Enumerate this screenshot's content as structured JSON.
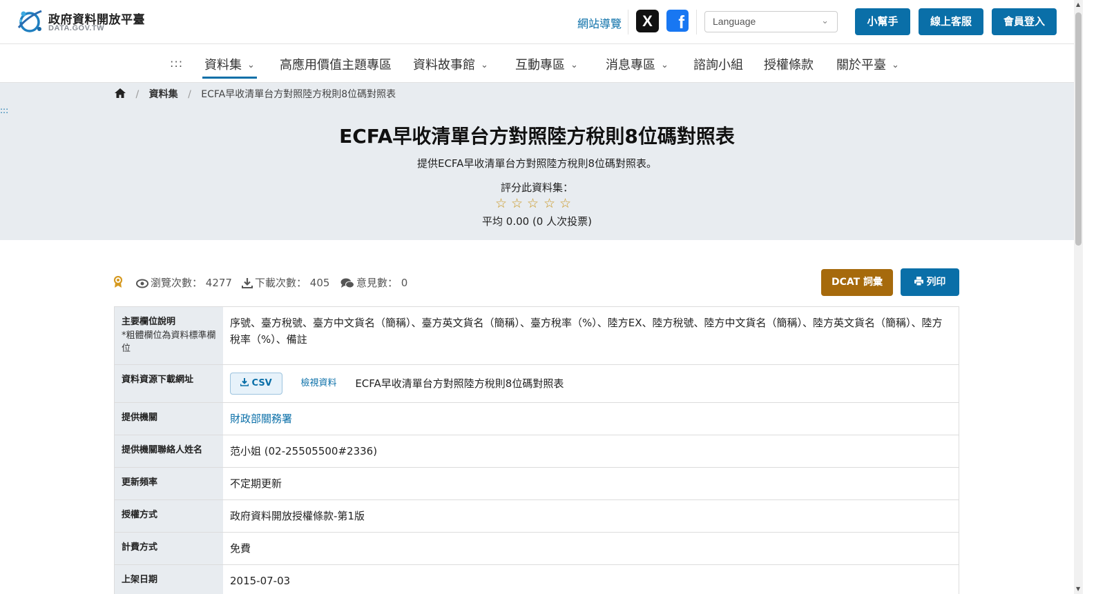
{
  "header": {
    "logo_cn": "政府資料開放平臺",
    "logo_en": "DATA.GOV.TW",
    "sitemap": "網站導覽",
    "social": [
      {
        "icon": "x-icon",
        "glyph": "X"
      },
      {
        "icon": "facebook-icon",
        "glyph": "f"
      }
    ],
    "language_placeholder": "Language",
    "buttons": [
      "小幫手",
      "線上客服",
      "會員登入"
    ]
  },
  "nav": {
    "dots": ":::",
    "items": [
      {
        "label": "資料集",
        "has_menu": true,
        "active": true
      },
      {
        "label": "高應用價值主題專區",
        "has_menu": false
      },
      {
        "label": "資料故事館",
        "has_menu": true
      },
      {
        "label": "互動專區",
        "has_menu": true
      },
      {
        "label": "消息專區",
        "has_menu": true
      },
      {
        "label": "諮詢小組",
        "has_menu": false
      },
      {
        "label": "授權條款",
        "has_menu": false
      },
      {
        "label": "關於平臺",
        "has_menu": true
      }
    ]
  },
  "breadcrumb": {
    "level1": "資料集",
    "current": "ECFA早收清單台方對照陸方稅則8位碼對照表"
  },
  "side_dots": ":::",
  "dataset": {
    "title": "ECFA早收清單台方對照陸方稅則8位碼對照表",
    "description": "提供ECFA早收清單台方對照陸方稅則8位碼對照表。",
    "rating_label": "評分此資料集：",
    "rating_stars": 5,
    "rating_value": 0,
    "rating_average": "平均 0.00 (0 人次投票)"
  },
  "stats": {
    "views_label": "瀏覽次數：",
    "views": "4277",
    "downloads_label": "下載次數：",
    "downloads": "405",
    "comments_label": "意見數：",
    "comments": "0"
  },
  "actions": {
    "dcat": "DCAT 詞彙",
    "print": "列印"
  },
  "table": {
    "fields_label": "主要欄位說明",
    "fields_note": "*粗體欄位為資料標準欄位",
    "fields_value": "序號、臺方稅號、臺方中文貨名（簡稱）、臺方英文貨名（簡稱）、臺方稅率（%）、陸方EX、陸方稅號、陸方中文貨名（簡稱）、陸方英文貨名（簡稱）、陸方稅率（%）、備註",
    "resource_label": "資料資源下載網址",
    "resource_format": "CSV",
    "resource_view": "檢視資料",
    "resource_name": "ECFA早收清單台方對照陸方稅則8位碼對照表",
    "rows": [
      {
        "label": "提供機關",
        "value": "財政部關務署",
        "link": true
      },
      {
        "label": "提供機關聯絡人姓名",
        "value": "范小姐 (02-25505500#2336)",
        "link": false
      },
      {
        "label": "更新頻率",
        "value": "不定期更新",
        "link": false
      },
      {
        "label": "授權方式",
        "value": "政府資料開放授權條款-第1版",
        "link": false
      },
      {
        "label": "計費方式",
        "value": "免費",
        "link": false
      },
      {
        "label": "上架日期",
        "value": "2015-07-03",
        "link": false
      }
    ]
  },
  "colors": {
    "primary": "#0a6fa8",
    "dcat": "#a66a0c",
    "hero_bg": "#e8ecf0",
    "star": "#c9951d"
  }
}
